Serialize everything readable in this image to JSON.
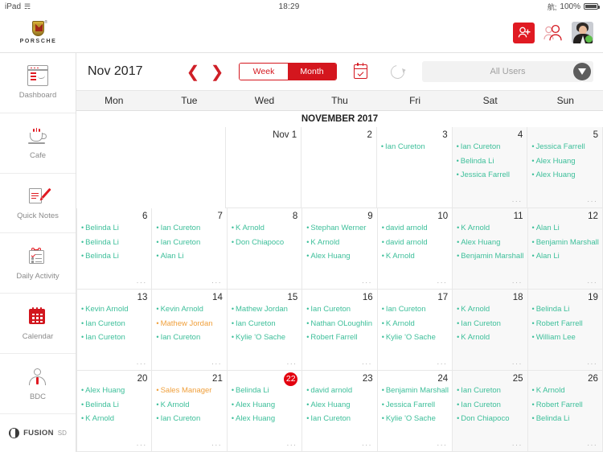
{
  "statusbar": {
    "device": "iPad",
    "wifi_icon": "wifi-icon",
    "time": "18:29",
    "lock_icon": "rotation-lock-icon",
    "battery": "100%"
  },
  "appbar": {
    "brand": "PORSCHE",
    "logo_icon": "porsche-crest-icon",
    "add_user_icon": "add-user-icon",
    "contacts_icon": "contacts-icon",
    "avatar_icon": "user-avatar"
  },
  "sidebar": {
    "items": [
      {
        "label": "Dashboard",
        "icon": "dashboard-icon",
        "active": false
      },
      {
        "label": "Cafe",
        "icon": "cafe-icon",
        "active": false
      },
      {
        "label": "Quick Notes",
        "icon": "quick-notes-icon",
        "active": false
      },
      {
        "label": "Daily Activity",
        "icon": "daily-activity-icon",
        "active": false
      },
      {
        "label": "Calendar",
        "icon": "calendar-icon",
        "active": true
      },
      {
        "label": "BDC",
        "icon": "bdc-icon",
        "active": false
      }
    ],
    "footer_brand": "FUSION",
    "footer_suffix": "SD",
    "footer_icon": "fusion-logo-icon"
  },
  "toolbar": {
    "month_title": "Nov 2017",
    "prev_icon": "chevron-left-icon",
    "next_icon": "chevron-right-icon",
    "week_label": "Week",
    "month_label": "Month",
    "active_view": "Month",
    "date_picker_icon": "calendar-picker-icon",
    "refresh_icon": "refresh-icon",
    "user_filter_value": "All Users",
    "filter_icon": "funnel-filter-icon",
    "accent_red": "#d4161e",
    "event_green": "#3dbf9a",
    "event_orange": "#f0a03c",
    "today_red": "#e3000f"
  },
  "calendar": {
    "weekdays": [
      "Mon",
      "Tue",
      "Wed",
      "Thu",
      "Fri",
      "Sat",
      "Sun"
    ],
    "month_label": "NOVEMBER 2017",
    "today": 22,
    "weeks": [
      [
        {
          "blank": true
        },
        {
          "blank": true
        },
        {
          "day": "Nov 1",
          "events": []
        },
        {
          "day": "2",
          "events": []
        },
        {
          "day": "3",
          "events": [
            {
              "name": "Ian Cureton",
              "color": "green"
            }
          ]
        },
        {
          "day": "4",
          "weekend": true,
          "more": true,
          "events": [
            {
              "name": "Ian Cureton",
              "color": "green"
            },
            {
              "name": "Belinda Li",
              "color": "green"
            },
            {
              "name": "Jessica Farrell",
              "color": "green"
            }
          ]
        },
        {
          "day": "5",
          "weekend": true,
          "more": true,
          "events": [
            {
              "name": "Jessica Farrell",
              "color": "green"
            },
            {
              "name": "Alex Huang",
              "color": "green"
            },
            {
              "name": "Alex Huang",
              "color": "green"
            }
          ]
        }
      ],
      [
        {
          "day": "6",
          "more": true,
          "events": [
            {
              "name": "Belinda Li",
              "color": "green"
            },
            {
              "name": "Belinda Li",
              "color": "green"
            },
            {
              "name": "Belinda Li",
              "color": "green"
            }
          ]
        },
        {
          "day": "7",
          "more": true,
          "events": [
            {
              "name": "Ian Cureton",
              "color": "green"
            },
            {
              "name": "Ian Cureton",
              "color": "green"
            },
            {
              "name": "Alan Li",
              "color": "green"
            }
          ]
        },
        {
          "day": "8",
          "events": [
            {
              "name": "K Arnold",
              "color": "green"
            },
            {
              "name": "Don Chiapoco",
              "color": "green"
            }
          ]
        },
        {
          "day": "9",
          "more": true,
          "events": [
            {
              "name": "Stephan Werner",
              "color": "green"
            },
            {
              "name": "K Arnold",
              "color": "green"
            },
            {
              "name": "Alex Huang",
              "color": "green"
            }
          ]
        },
        {
          "day": "10",
          "more": true,
          "events": [
            {
              "name": "david arnold",
              "color": "green"
            },
            {
              "name": "david arnold",
              "color": "green"
            },
            {
              "name": "K Arnold",
              "color": "green"
            }
          ]
        },
        {
          "day": "11",
          "weekend": true,
          "more": true,
          "events": [
            {
              "name": "K Arnold",
              "color": "green"
            },
            {
              "name": "Alex Huang",
              "color": "green"
            },
            {
              "name": "Benjamin Marshall",
              "color": "green"
            }
          ]
        },
        {
          "day": "12",
          "weekend": true,
          "more": true,
          "events": [
            {
              "name": "Alan Li",
              "color": "green"
            },
            {
              "name": "Benjamin Marshall",
              "color": "green"
            },
            {
              "name": "Alan Li",
              "color": "green"
            }
          ]
        }
      ],
      [
        {
          "day": "13",
          "more": true,
          "events": [
            {
              "name": "Kevin Arnold",
              "color": "green"
            },
            {
              "name": "Ian Cureton",
              "color": "green"
            },
            {
              "name": "Ian Cureton",
              "color": "green"
            }
          ]
        },
        {
          "day": "14",
          "more": true,
          "events": [
            {
              "name": "Kevin Arnold",
              "color": "green"
            },
            {
              "name": "Mathew Jordan",
              "color": "orange"
            },
            {
              "name": "Ian Cureton",
              "color": "green"
            }
          ]
        },
        {
          "day": "15",
          "more": true,
          "events": [
            {
              "name": "Mathew Jordan",
              "color": "green"
            },
            {
              "name": "Ian Cureton",
              "color": "green"
            },
            {
              "name": "Kylie 'O Sache",
              "color": "green"
            }
          ]
        },
        {
          "day": "16",
          "more": true,
          "events": [
            {
              "name": "Ian Cureton",
              "color": "green"
            },
            {
              "name": "Nathan OLoughlin",
              "color": "green"
            },
            {
              "name": "Robert Farrell",
              "color": "green"
            }
          ]
        },
        {
          "day": "17",
          "more": true,
          "events": [
            {
              "name": "Ian Cureton",
              "color": "green"
            },
            {
              "name": "K Arnold",
              "color": "green"
            },
            {
              "name": "Kylie 'O Sache",
              "color": "green"
            }
          ]
        },
        {
          "day": "18",
          "weekend": true,
          "more": true,
          "events": [
            {
              "name": "K Arnold",
              "color": "green"
            },
            {
              "name": "Ian Cureton",
              "color": "green"
            },
            {
              "name": "K Arnold",
              "color": "green"
            }
          ]
        },
        {
          "day": "19",
          "weekend": true,
          "more": true,
          "events": [
            {
              "name": "Belinda Li",
              "color": "green"
            },
            {
              "name": "Robert Farrell",
              "color": "green"
            },
            {
              "name": "William  Lee",
              "color": "green"
            }
          ]
        }
      ],
      [
        {
          "day": "20",
          "more": true,
          "events": [
            {
              "name": "Alex Huang",
              "color": "green"
            },
            {
              "name": "Belinda Li",
              "color": "green"
            },
            {
              "name": "K Arnold",
              "color": "green"
            }
          ]
        },
        {
          "day": "21",
          "more": true,
          "events": [
            {
              "name": "Sales  Manager",
              "color": "orange"
            },
            {
              "name": "K Arnold",
              "color": "green"
            },
            {
              "name": "Ian Cureton",
              "color": "green"
            }
          ]
        },
        {
          "day": "22",
          "today": true,
          "more": true,
          "events": [
            {
              "name": "Belinda Li",
              "color": "green"
            },
            {
              "name": "Alex Huang",
              "color": "green"
            },
            {
              "name": "Alex Huang",
              "color": "green"
            }
          ]
        },
        {
          "day": "23",
          "more": true,
          "events": [
            {
              "name": "david arnold",
              "color": "green"
            },
            {
              "name": "Alex Huang",
              "color": "green"
            },
            {
              "name": "Ian Cureton",
              "color": "green"
            }
          ]
        },
        {
          "day": "24",
          "more": true,
          "events": [
            {
              "name": "Benjamin Marshall",
              "color": "green"
            },
            {
              "name": "Jessica Farrell",
              "color": "green"
            },
            {
              "name": "Kylie 'O Sache",
              "color": "green"
            }
          ]
        },
        {
          "day": "25",
          "weekend": true,
          "more": true,
          "events": [
            {
              "name": "Ian Cureton",
              "color": "green"
            },
            {
              "name": "Ian Cureton",
              "color": "green"
            },
            {
              "name": "Don Chiapoco",
              "color": "green"
            }
          ]
        },
        {
          "day": "26",
          "weekend": true,
          "more": true,
          "events": [
            {
              "name": "K Arnold",
              "color": "green"
            },
            {
              "name": "Robert Farrell",
              "color": "green"
            },
            {
              "name": "Belinda Li",
              "color": "green"
            }
          ]
        }
      ]
    ],
    "more_glyph": "···"
  }
}
